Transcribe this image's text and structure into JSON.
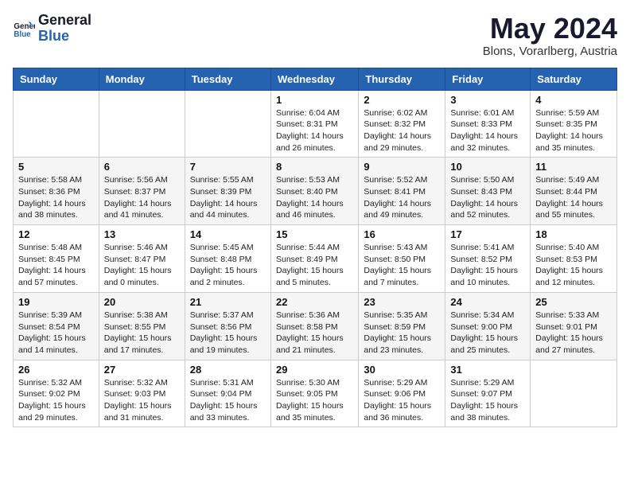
{
  "header": {
    "logo_line1": "General",
    "logo_line2": "Blue",
    "month_year": "May 2024",
    "location": "Blons, Vorarlberg, Austria"
  },
  "weekdays": [
    "Sunday",
    "Monday",
    "Tuesday",
    "Wednesday",
    "Thursday",
    "Friday",
    "Saturday"
  ],
  "weeks": [
    [
      {
        "day": "",
        "info": ""
      },
      {
        "day": "",
        "info": ""
      },
      {
        "day": "",
        "info": ""
      },
      {
        "day": "1",
        "info": "Sunrise: 6:04 AM\nSunset: 8:31 PM\nDaylight: 14 hours\nand 26 minutes."
      },
      {
        "day": "2",
        "info": "Sunrise: 6:02 AM\nSunset: 8:32 PM\nDaylight: 14 hours\nand 29 minutes."
      },
      {
        "day": "3",
        "info": "Sunrise: 6:01 AM\nSunset: 8:33 PM\nDaylight: 14 hours\nand 32 minutes."
      },
      {
        "day": "4",
        "info": "Sunrise: 5:59 AM\nSunset: 8:35 PM\nDaylight: 14 hours\nand 35 minutes."
      }
    ],
    [
      {
        "day": "5",
        "info": "Sunrise: 5:58 AM\nSunset: 8:36 PM\nDaylight: 14 hours\nand 38 minutes."
      },
      {
        "day": "6",
        "info": "Sunrise: 5:56 AM\nSunset: 8:37 PM\nDaylight: 14 hours\nand 41 minutes."
      },
      {
        "day": "7",
        "info": "Sunrise: 5:55 AM\nSunset: 8:39 PM\nDaylight: 14 hours\nand 44 minutes."
      },
      {
        "day": "8",
        "info": "Sunrise: 5:53 AM\nSunset: 8:40 PM\nDaylight: 14 hours\nand 46 minutes."
      },
      {
        "day": "9",
        "info": "Sunrise: 5:52 AM\nSunset: 8:41 PM\nDaylight: 14 hours\nand 49 minutes."
      },
      {
        "day": "10",
        "info": "Sunrise: 5:50 AM\nSunset: 8:43 PM\nDaylight: 14 hours\nand 52 minutes."
      },
      {
        "day": "11",
        "info": "Sunrise: 5:49 AM\nSunset: 8:44 PM\nDaylight: 14 hours\nand 55 minutes."
      }
    ],
    [
      {
        "day": "12",
        "info": "Sunrise: 5:48 AM\nSunset: 8:45 PM\nDaylight: 14 hours\nand 57 minutes."
      },
      {
        "day": "13",
        "info": "Sunrise: 5:46 AM\nSunset: 8:47 PM\nDaylight: 15 hours\nand 0 minutes."
      },
      {
        "day": "14",
        "info": "Sunrise: 5:45 AM\nSunset: 8:48 PM\nDaylight: 15 hours\nand 2 minutes."
      },
      {
        "day": "15",
        "info": "Sunrise: 5:44 AM\nSunset: 8:49 PM\nDaylight: 15 hours\nand 5 minutes."
      },
      {
        "day": "16",
        "info": "Sunrise: 5:43 AM\nSunset: 8:50 PM\nDaylight: 15 hours\nand 7 minutes."
      },
      {
        "day": "17",
        "info": "Sunrise: 5:41 AM\nSunset: 8:52 PM\nDaylight: 15 hours\nand 10 minutes."
      },
      {
        "day": "18",
        "info": "Sunrise: 5:40 AM\nSunset: 8:53 PM\nDaylight: 15 hours\nand 12 minutes."
      }
    ],
    [
      {
        "day": "19",
        "info": "Sunrise: 5:39 AM\nSunset: 8:54 PM\nDaylight: 15 hours\nand 14 minutes."
      },
      {
        "day": "20",
        "info": "Sunrise: 5:38 AM\nSunset: 8:55 PM\nDaylight: 15 hours\nand 17 minutes."
      },
      {
        "day": "21",
        "info": "Sunrise: 5:37 AM\nSunset: 8:56 PM\nDaylight: 15 hours\nand 19 minutes."
      },
      {
        "day": "22",
        "info": "Sunrise: 5:36 AM\nSunset: 8:58 PM\nDaylight: 15 hours\nand 21 minutes."
      },
      {
        "day": "23",
        "info": "Sunrise: 5:35 AM\nSunset: 8:59 PM\nDaylight: 15 hours\nand 23 minutes."
      },
      {
        "day": "24",
        "info": "Sunrise: 5:34 AM\nSunset: 9:00 PM\nDaylight: 15 hours\nand 25 minutes."
      },
      {
        "day": "25",
        "info": "Sunrise: 5:33 AM\nSunset: 9:01 PM\nDaylight: 15 hours\nand 27 minutes."
      }
    ],
    [
      {
        "day": "26",
        "info": "Sunrise: 5:32 AM\nSunset: 9:02 PM\nDaylight: 15 hours\nand 29 minutes."
      },
      {
        "day": "27",
        "info": "Sunrise: 5:32 AM\nSunset: 9:03 PM\nDaylight: 15 hours\nand 31 minutes."
      },
      {
        "day": "28",
        "info": "Sunrise: 5:31 AM\nSunset: 9:04 PM\nDaylight: 15 hours\nand 33 minutes."
      },
      {
        "day": "29",
        "info": "Sunrise: 5:30 AM\nSunset: 9:05 PM\nDaylight: 15 hours\nand 35 minutes."
      },
      {
        "day": "30",
        "info": "Sunrise: 5:29 AM\nSunset: 9:06 PM\nDaylight: 15 hours\nand 36 minutes."
      },
      {
        "day": "31",
        "info": "Sunrise: 5:29 AM\nSunset: 9:07 PM\nDaylight: 15 hours\nand 38 minutes."
      },
      {
        "day": "",
        "info": ""
      }
    ]
  ]
}
